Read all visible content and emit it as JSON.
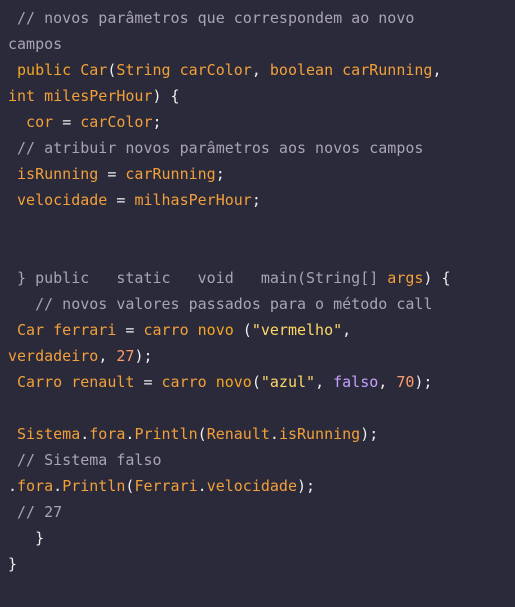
{
  "code": {
    "lines": [
      [
        {
          "t": " // novos parâmetros que correspondem ao novo",
          "c": "comment"
        }
      ],
      [
        {
          "t": "campos",
          "c": "comment"
        }
      ],
      [
        {
          "t": " public ",
          "c": "keyword"
        },
        {
          "t": "Car",
          "c": "ident"
        },
        {
          "t": "(",
          "c": "punct"
        },
        {
          "t": "String carColor",
          "c": "ident"
        },
        {
          "t": ", ",
          "c": "punct"
        },
        {
          "t": "boolean carRunning",
          "c": "ident"
        },
        {
          "t": ",",
          "c": "punct"
        }
      ],
      [
        {
          "t": "int milesPerHour",
          "c": "ident"
        },
        {
          "t": ") {",
          "c": "punct"
        }
      ],
      [
        {
          "t": "  cor ",
          "c": "ident"
        },
        {
          "t": "= ",
          "c": "punct"
        },
        {
          "t": "carColor",
          "c": "ident"
        },
        {
          "t": ";",
          "c": "punct"
        }
      ],
      [
        {
          "t": " // atribuir novos parâmetros aos novos campos",
          "c": "comment"
        }
      ],
      [
        {
          "t": " isRunning ",
          "c": "ident"
        },
        {
          "t": "= ",
          "c": "punct"
        },
        {
          "t": "carRunning",
          "c": "ident"
        },
        {
          "t": ";",
          "c": "punct"
        }
      ],
      [
        {
          "t": " velocidade ",
          "c": "ident"
        },
        {
          "t": "= ",
          "c": "punct"
        },
        {
          "t": "milhasPerHour",
          "c": "ident"
        },
        {
          "t": ";",
          "c": "punct"
        }
      ],
      [
        {
          "t": "",
          "c": "plain"
        }
      ],
      [
        {
          "t": "",
          "c": "plain"
        }
      ],
      [
        {
          "t": " } public   static   void   main(String[] ",
          "c": "comment"
        },
        {
          "t": "args",
          "c": "ident"
        },
        {
          "t": ") {",
          "c": "punct"
        }
      ],
      [
        {
          "t": "   // novos valores passados para o método call",
          "c": "comment"
        }
      ],
      [
        {
          "t": " Car ferrari ",
          "c": "ident"
        },
        {
          "t": "= ",
          "c": "punct"
        },
        {
          "t": "carro ",
          "c": "ident"
        },
        {
          "t": "novo",
          "c": "keyword"
        },
        {
          "t": " (",
          "c": "punct"
        },
        {
          "t": "\"vermelho\"",
          "c": "string"
        },
        {
          "t": ",",
          "c": "punct"
        }
      ],
      [
        {
          "t": "verdadeiro",
          "c": "ident"
        },
        {
          "t": ", ",
          "c": "punct"
        },
        {
          "t": "27",
          "c": "number"
        },
        {
          "t": ");",
          "c": "punct"
        }
      ],
      [
        {
          "t": " Carro renault ",
          "c": "ident"
        },
        {
          "t": "= ",
          "c": "punct"
        },
        {
          "t": "carro ",
          "c": "ident"
        },
        {
          "t": "novo",
          "c": "keyword"
        },
        {
          "t": "(",
          "c": "punct"
        },
        {
          "t": "\"azul\"",
          "c": "string"
        },
        {
          "t": ", ",
          "c": "punct"
        },
        {
          "t": "falso",
          "c": "ident2"
        },
        {
          "t": ", ",
          "c": "punct"
        },
        {
          "t": "70",
          "c": "number"
        },
        {
          "t": ");",
          "c": "punct"
        }
      ],
      [
        {
          "t": "",
          "c": "plain"
        }
      ],
      [
        {
          "t": " Sistema",
          "c": "ident"
        },
        {
          "t": ".",
          "c": "punct"
        },
        {
          "t": "fora",
          "c": "ident"
        },
        {
          "t": ".",
          "c": "punct"
        },
        {
          "t": "Println",
          "c": "ident"
        },
        {
          "t": "(",
          "c": "punct"
        },
        {
          "t": "Renault",
          "c": "ident"
        },
        {
          "t": ".",
          "c": "punct"
        },
        {
          "t": "isRunning",
          "c": "ident"
        },
        {
          "t": ");",
          "c": "punct"
        }
      ],
      [
        {
          "t": " // Sistema falso",
          "c": "comment"
        }
      ],
      [
        {
          "t": ".",
          "c": "punct"
        },
        {
          "t": "fora",
          "c": "ident"
        },
        {
          "t": ".",
          "c": "punct"
        },
        {
          "t": "Println",
          "c": "ident"
        },
        {
          "t": "(",
          "c": "punct"
        },
        {
          "t": "Ferrari",
          "c": "ident"
        },
        {
          "t": ".",
          "c": "punct"
        },
        {
          "t": "velocidade",
          "c": "ident"
        },
        {
          "t": ");",
          "c": "punct"
        }
      ],
      [
        {
          "t": " // 27",
          "c": "comment"
        }
      ],
      [
        {
          "t": "   }",
          "c": "punct"
        }
      ],
      [
        {
          "t": "}",
          "c": "punct"
        }
      ]
    ]
  },
  "colors": {
    "background": "#2a2a3a",
    "comment": "#a7a4b5",
    "keyword": "#f5a623",
    "identifier": "#f2a03a",
    "string": "#ffd866",
    "number": "#ff9d6a",
    "purple": "#c7a0ff"
  }
}
